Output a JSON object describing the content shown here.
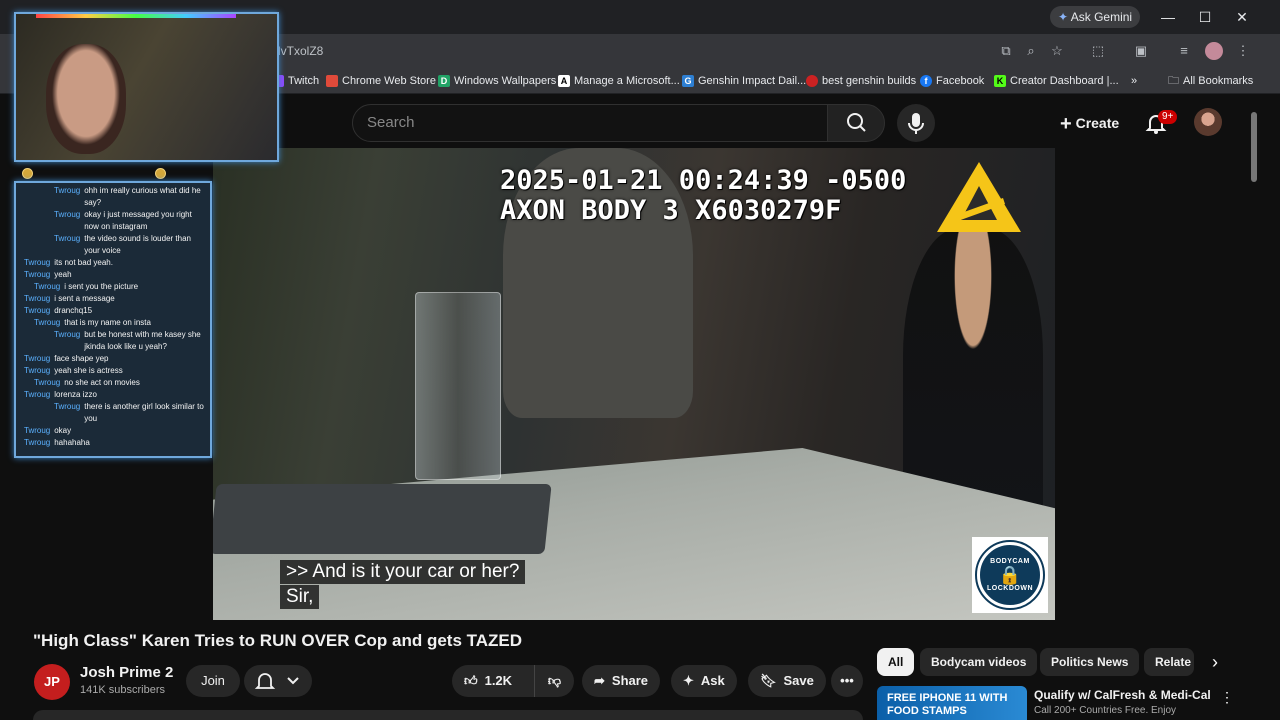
{
  "browser": {
    "ask_gemini": "Ask Gemini",
    "url_fragment": "lvTxolZ8",
    "bookmarks": [
      {
        "label": "Twitch",
        "color": "#9146ff",
        "glyph": ""
      },
      {
        "label": "Chrome Web Store",
        "color": "#e04a3a",
        "glyph": ""
      },
      {
        "label": "Windows Wallpapers",
        "color": "#21a366",
        "glyph": "D"
      },
      {
        "label": "Manage a Microsoft...",
        "color": "#222222",
        "glyph": "A"
      },
      {
        "label": "Genshin Impact Dail...",
        "color": "#2d7fd3",
        "glyph": "G"
      },
      {
        "label": "best genshin builds",
        "color": "#cc2222",
        "glyph": ""
      },
      {
        "label": "Facebook",
        "color": "#1877f2",
        "glyph": "f"
      },
      {
        "label": "Creator Dashboard |...",
        "color": "#53fc18",
        "glyph": "K"
      }
    ],
    "all_bookmarks": "All Bookmarks",
    "more_bookmarks": "»"
  },
  "header": {
    "search_placeholder": "Search",
    "create_label": "Create",
    "notif_badge": "9+"
  },
  "video": {
    "timestamp": "2025-01-21 00:24:39 -0500",
    "device": "AXON BODY 3 X6030279F",
    "caption_line1": ">> And is it your car or her?",
    "caption_line2": "Sir,",
    "badge_top": "BODYCAM",
    "badge_bottom": "LOCKDOWN"
  },
  "chat": {
    "lines": [
      {
        "user": "Twroug",
        "msg": "ohh im really curious what did he say?",
        "indent": 3
      },
      {
        "user": "Twroug",
        "msg": "okay i just messaged you right now on instagram",
        "indent": 3
      },
      {
        "user": "Twroug",
        "msg": "the video sound is louder than your voice",
        "indent": 3
      },
      {
        "user": "Twroug",
        "msg": "its not bad yeah.",
        "indent": 0
      },
      {
        "user": "Twroug",
        "msg": "yeah",
        "indent": 0
      },
      {
        "user": "Twroug",
        "msg": "i sent you the picture",
        "indent": 1
      },
      {
        "user": "Twroug",
        "msg": "i sent a message",
        "indent": 0
      },
      {
        "user": "Twroug",
        "msg": "dranchq15",
        "indent": 0
      },
      {
        "user": "Twroug",
        "msg": "that is my name on insta",
        "indent": 1
      },
      {
        "user": "Twroug",
        "msg": "but be honest with me kasey she jkinda look like u yeah?",
        "indent": 3
      },
      {
        "user": "Twroug",
        "msg": "face shape yep",
        "indent": 0
      },
      {
        "user": "Twroug",
        "msg": "yeah she is actress",
        "indent": 0
      },
      {
        "user": "Twroug",
        "msg": "no she act on movies",
        "indent": 1
      },
      {
        "user": "Twroug",
        "msg": "lorenza izzo",
        "indent": 0
      },
      {
        "user": "Twroug",
        "msg": "there is another girl look similar to you",
        "indent": 3
      },
      {
        "user": "Twroug",
        "msg": "okay",
        "indent": 0
      },
      {
        "user": "Twroug",
        "msg": "hahahaha",
        "indent": 0
      }
    ]
  },
  "watch": {
    "title": "\"High Class\" Karen Tries to RUN OVER Cop and gets TAZED",
    "channel_initials": "JP",
    "channel_name": "Josh Prime 2",
    "subscribers": "141K subscribers",
    "join_label": "Join",
    "like_count": "1.2K",
    "share_label": "Share",
    "ask_label": "Ask",
    "save_label": "Save"
  },
  "chips": [
    "All",
    "Bodycam videos",
    "Politics News",
    "Relate"
  ],
  "ad": {
    "thumb_text": "FREE IPHONE 11 WITH FOOD STAMPS",
    "title": "Qualify w/ CalFresh & Medi-Cal",
    "subtitle": "Call 200+ Countries Free. Enjoy"
  }
}
